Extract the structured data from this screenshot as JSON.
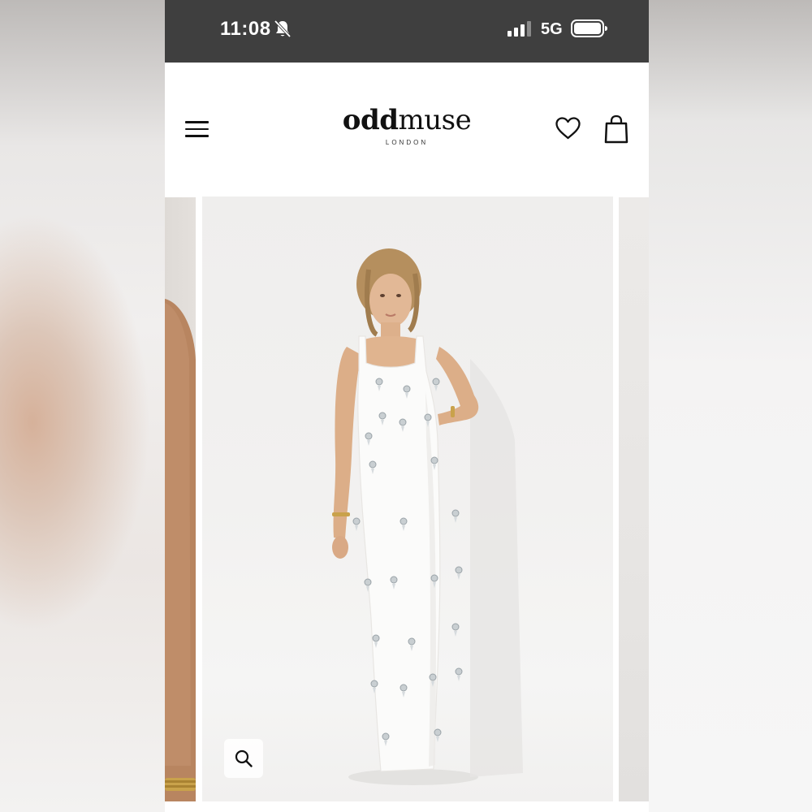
{
  "status_bar": {
    "time": "11:08",
    "network": "5G",
    "icons": [
      "bell-slash-icon",
      "signal-icon",
      "battery-icon"
    ]
  },
  "header": {
    "logo_bold": "odd",
    "logo_light": "muse",
    "logo_sub": "LONDON",
    "icons": [
      "menu-icon",
      "heart-icon",
      "shopping-bag-icon"
    ]
  },
  "gallery": {
    "zoom_icon": "magnifier-icon"
  },
  "colors": {
    "status_bar_bg": "#3f3f3f",
    "text": "#111111",
    "dress": "#fbfbfa"
  }
}
